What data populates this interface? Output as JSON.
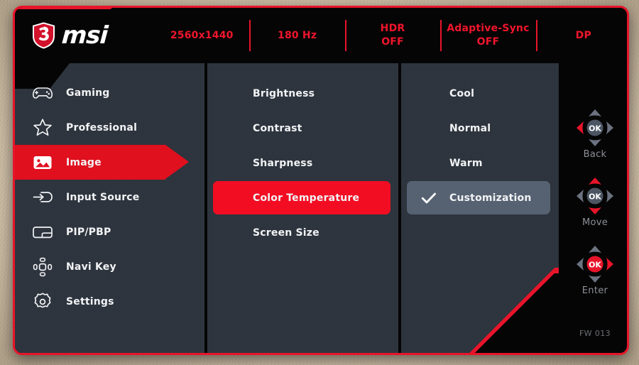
{
  "brand": {
    "logo_icon": "msi-dragon-shield-icon",
    "wordmark": "msi"
  },
  "header": {
    "status": [
      {
        "icon": "resolution-status",
        "primary": "2560x1440",
        "secondary": ""
      },
      {
        "icon": "refresh-rate-status",
        "primary": "180 Hz",
        "secondary": ""
      },
      {
        "icon": "hdr-status",
        "primary": "HDR",
        "secondary": "OFF"
      },
      {
        "icon": "adaptive-sync-status",
        "primary": "Adaptive-Sync",
        "secondary": "OFF"
      },
      {
        "icon": "input-port-status",
        "primary": "DP",
        "secondary": ""
      }
    ]
  },
  "sidebar": {
    "items": [
      {
        "label": "Gaming",
        "icon": "gamepad-icon",
        "selected": false
      },
      {
        "label": "Professional",
        "icon": "star-icon",
        "selected": false
      },
      {
        "label": "Image",
        "icon": "picture-icon",
        "selected": true
      },
      {
        "label": "Input Source",
        "icon": "input-arrow-icon",
        "selected": false
      },
      {
        "label": "PIP/PBP",
        "icon": "pip-pbp-icon",
        "selected": false
      },
      {
        "label": "Navi Key",
        "icon": "navi-key-icon",
        "selected": false
      },
      {
        "label": "Settings",
        "icon": "gear-icon",
        "selected": false
      }
    ]
  },
  "submenu": {
    "items": [
      {
        "label": "Brightness",
        "selected": false
      },
      {
        "label": "Contrast",
        "selected": false
      },
      {
        "label": "Sharpness",
        "selected": false
      },
      {
        "label": "Color Temperature",
        "selected": true
      },
      {
        "label": "Screen Size",
        "selected": false
      }
    ]
  },
  "options": {
    "items": [
      {
        "label": "Cool",
        "checked": false
      },
      {
        "label": "Normal",
        "checked": false
      },
      {
        "label": "Warm",
        "checked": false
      },
      {
        "label": "Customization",
        "checked": true
      }
    ]
  },
  "navkeys": {
    "items": [
      {
        "caption": "Back",
        "icon": "dpad-left-icon",
        "active": "left"
      },
      {
        "caption": "Move",
        "icon": "dpad-updown-icon",
        "active": "updown"
      },
      {
        "caption": "Enter",
        "icon": "dpad-right-icon",
        "active": "right"
      }
    ],
    "firmware": "FW 013"
  },
  "colors": {
    "accent_red": "#e8142a",
    "highlight_red": "#f20d23",
    "panel": "#2a313a",
    "option_highlight": "#566272",
    "text": "#f2f3f5",
    "caption": "#8d9097"
  }
}
